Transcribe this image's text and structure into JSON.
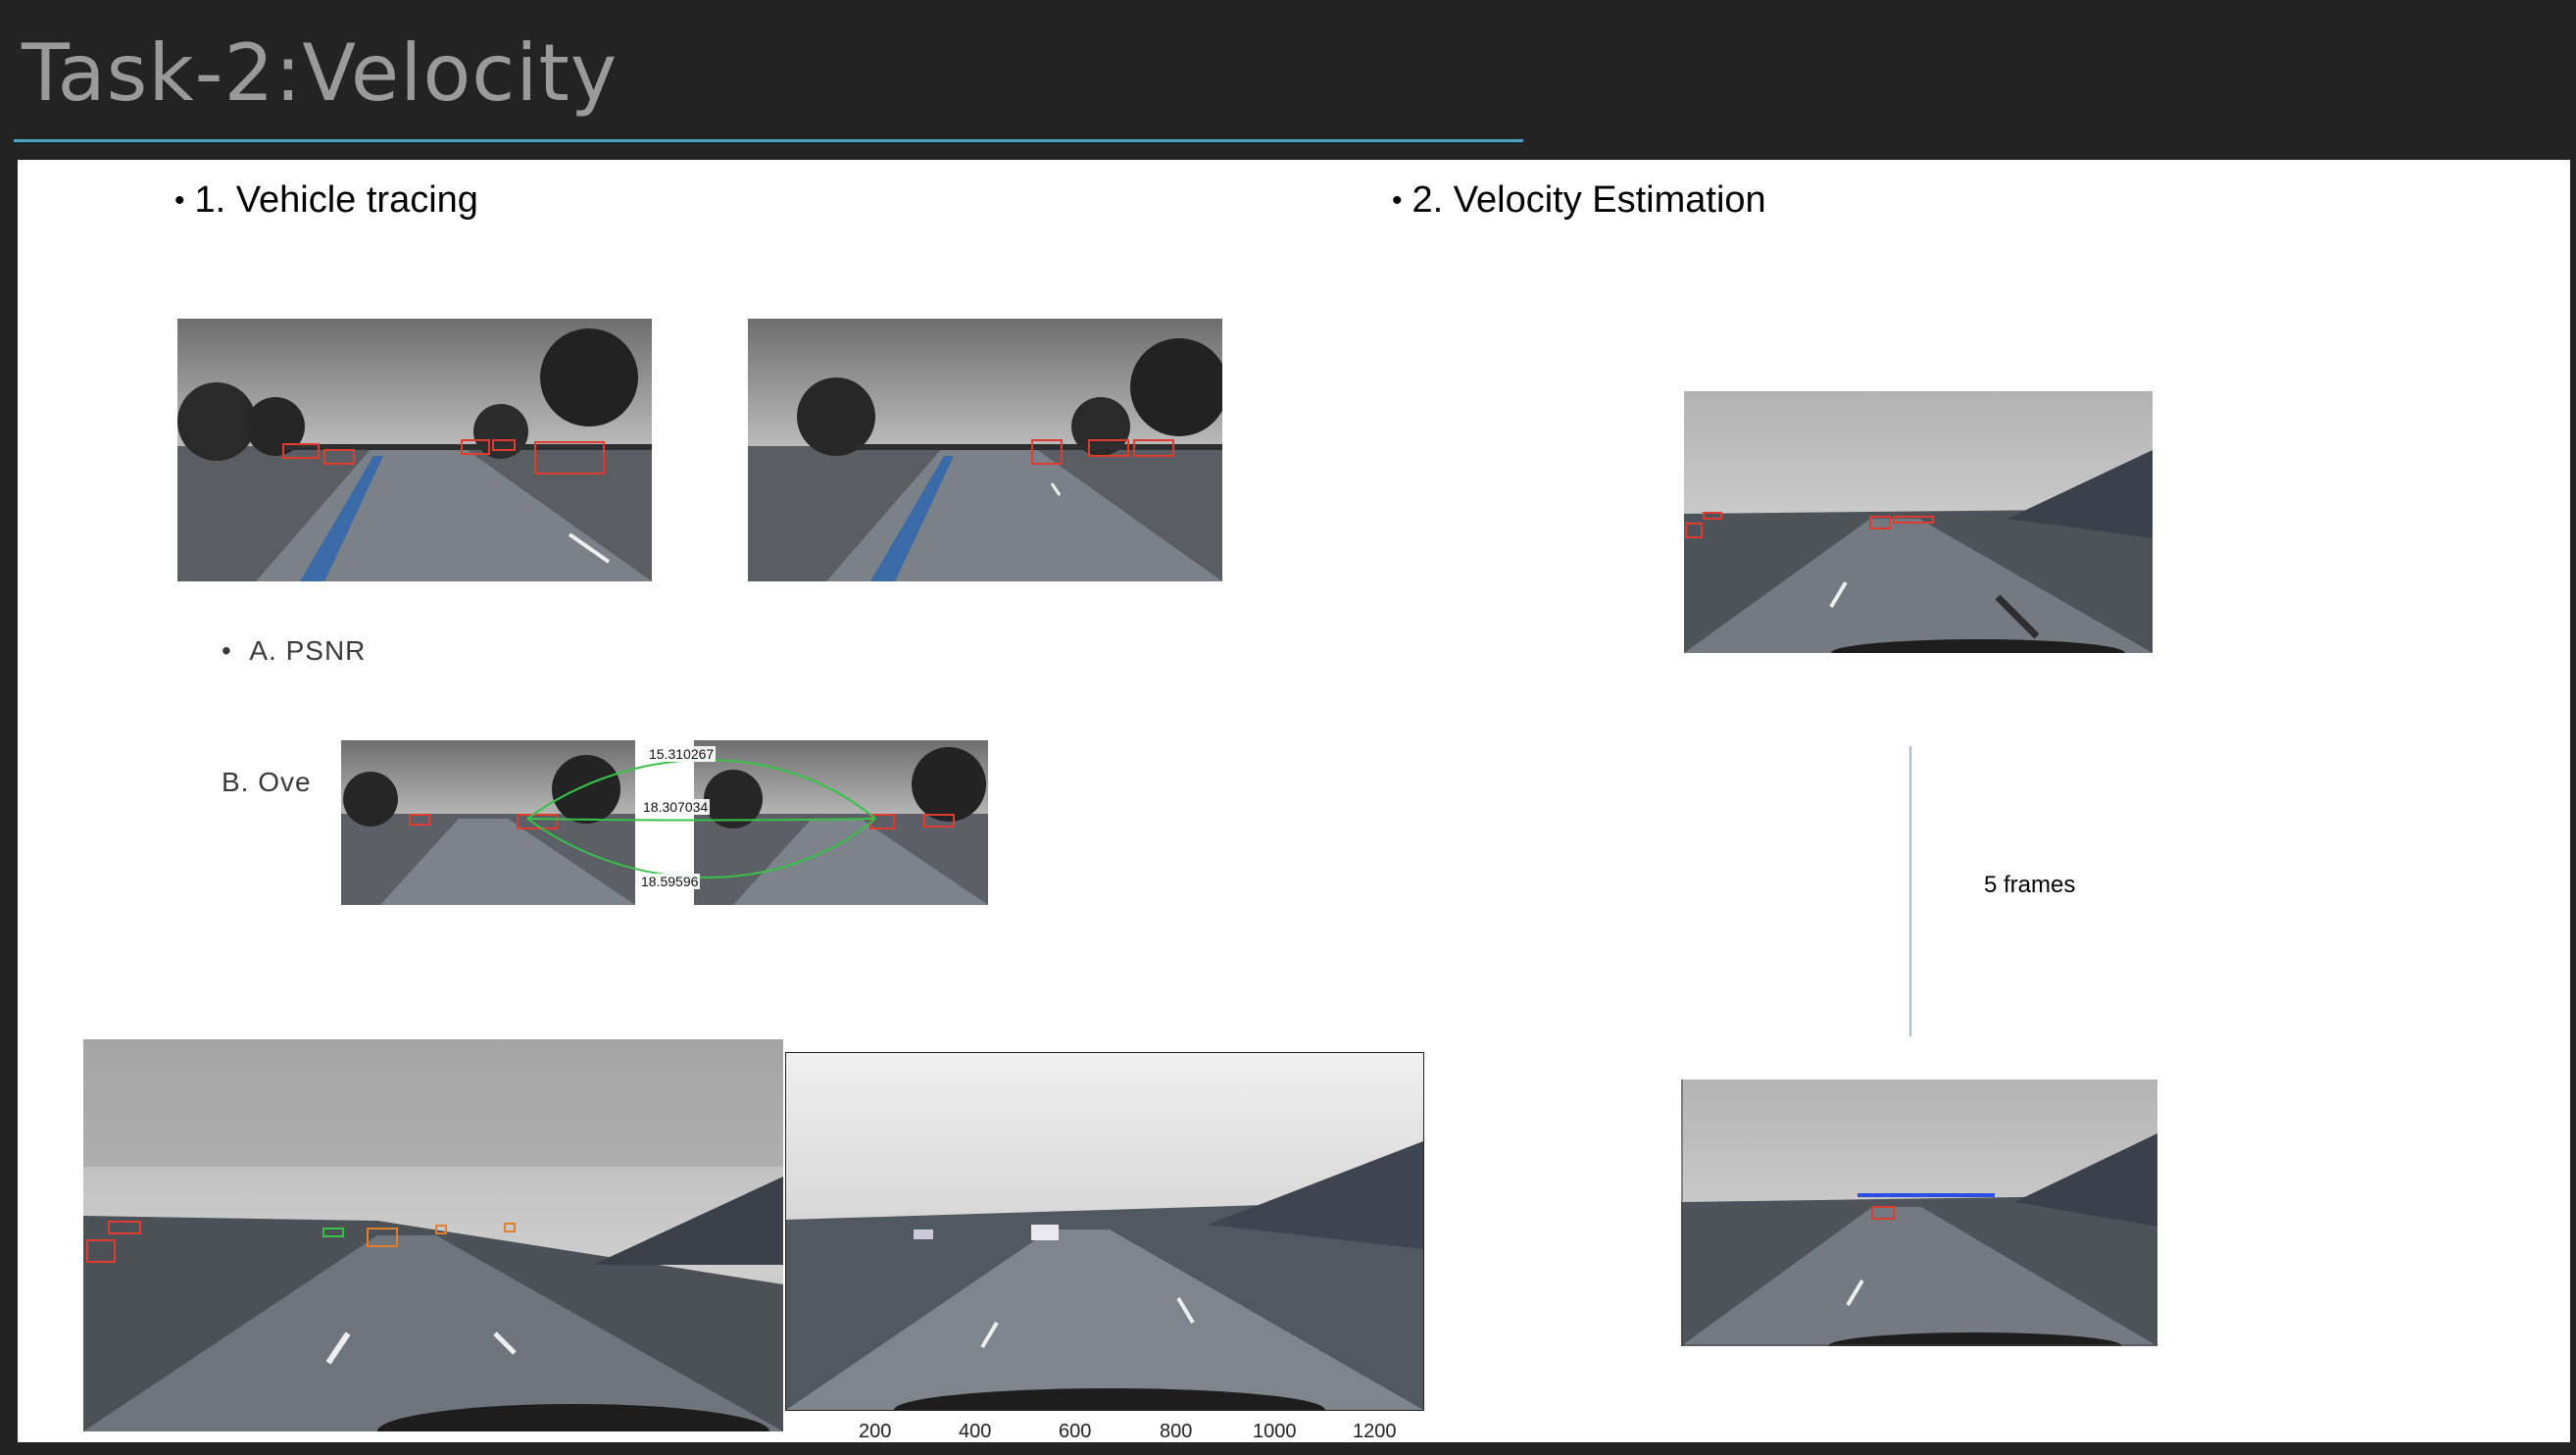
{
  "title": "Task-2:Velocity",
  "sections": {
    "left_heading": "1. Vehicle tracing",
    "right_heading": "2. Velocity Estimation",
    "sub_a": "A. PSNR",
    "sub_b": "B. Ove"
  },
  "psnr_values": [
    "15.310267",
    "18.307034",
    "18.59596"
  ],
  "frames_label": "5 frames",
  "x_ticks": [
    "200",
    "400",
    "600",
    "800",
    "1000",
    "1200"
  ],
  "colors": {
    "accent_rule": "#4aa3c7",
    "box_red": "#e03b2f",
    "match_green": "#39c24a",
    "box_blue": "#2b4fe0"
  }
}
